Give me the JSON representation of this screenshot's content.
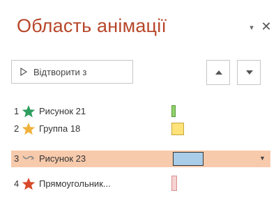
{
  "pane": {
    "title": "Область анімації",
    "options_glyph": "▾",
    "close_glyph": "✕"
  },
  "toolbar": {
    "play_label": "Відтворити з",
    "up_icon": "triangle-up-icon",
    "down_icon": "triangle-down-icon"
  },
  "animations": [
    {
      "number": "1",
      "label": "Рисунок 21",
      "effect_icon": "star-icon",
      "icon_color": "#2e9e5e",
      "bar_color": "#8fd16a",
      "bar_border": "#5a9a3c"
    },
    {
      "number": "2",
      "label": "Группа 18",
      "effect_icon": "star-icon",
      "icon_color": "#f0b23c",
      "bar_color": "#ffe27a",
      "bar_border": "#c9a63a"
    },
    {
      "number": "3",
      "label": "Рисунок 23",
      "effect_icon": "motion-path-icon",
      "icon_color": "#8a8a8a",
      "bar_color": "#a9cde8",
      "bar_border": "#333333",
      "selected": true
    },
    {
      "number": "4",
      "label": "Прямоугольник...",
      "effect_icon": "star-icon",
      "icon_color": "#d84a2a",
      "bar_color": "#f7d2d2",
      "bar_border": "#d89090"
    }
  ]
}
